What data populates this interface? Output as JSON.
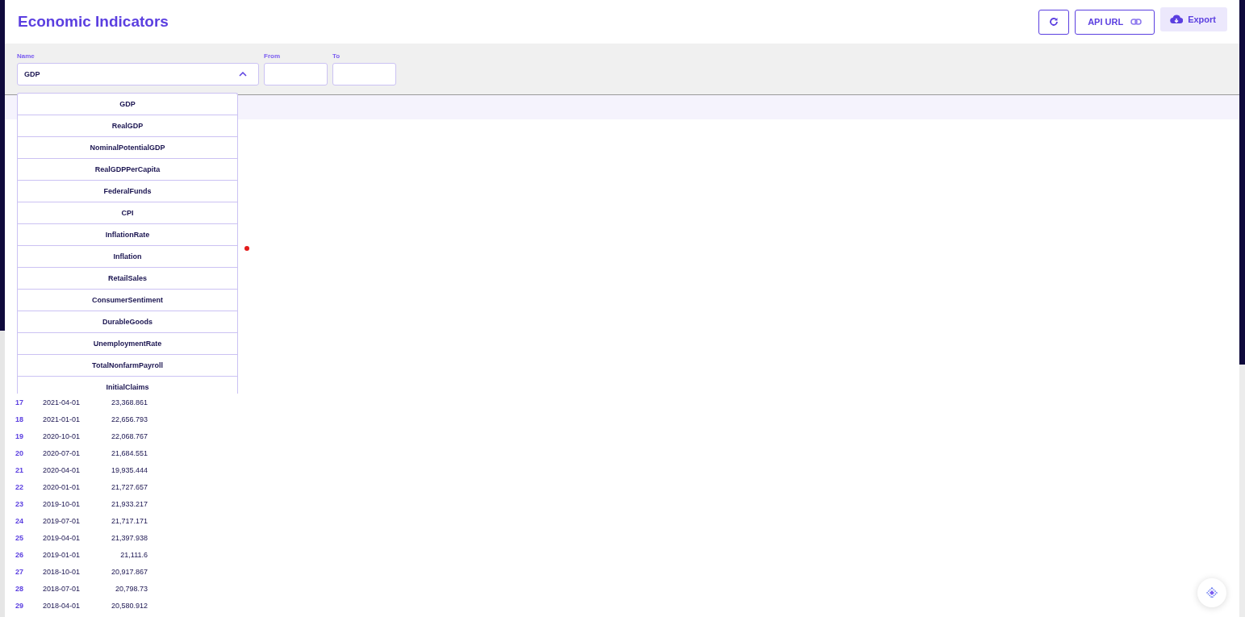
{
  "header": {
    "title": "Economic Indicators",
    "buttons": [
      {
        "kind": "refresh"
      },
      {
        "kind": "link",
        "label": "API URL"
      },
      {
        "kind": "export",
        "label": "Export"
      }
    ]
  },
  "filters": {
    "name": {
      "label": "Name",
      "value": "GDP",
      "expanded": true,
      "options": [
        "GDP",
        "RealGDP",
        "NominalPotentialGDP",
        "RealGDPPerCapita",
        "FederalFunds",
        "CPI",
        "InflationRate",
        "Inflation",
        "RetailSales",
        "ConsumerSentiment",
        "DurableGoods",
        "UnemploymentRate",
        "TotalNonfarmPayroll",
        "InitialClaims"
      ]
    },
    "from": {
      "label": "From"
    },
    "to": {
      "label": "To"
    }
  },
  "table": {
    "rows": [
      {
        "index": "17",
        "date": "2021-04-01",
        "value": "23,368.861"
      },
      {
        "index": "18",
        "date": "2021-01-01",
        "value": "22,656.793"
      },
      {
        "index": "19",
        "date": "2020-10-01",
        "value": "22,068.767"
      },
      {
        "index": "20",
        "date": "2020-07-01",
        "value": "21,684.551"
      },
      {
        "index": "21",
        "date": "2020-04-01",
        "value": "19,935.444"
      },
      {
        "index": "22",
        "date": "2020-01-01",
        "value": "21,727.657"
      },
      {
        "index": "23",
        "date": "2019-10-01",
        "value": "21,933.217"
      },
      {
        "index": "24",
        "date": "2019-07-01",
        "value": "21,717.171"
      },
      {
        "index": "25",
        "date": "2019-04-01",
        "value": "21,397.938"
      },
      {
        "index": "26",
        "date": "2019-01-01",
        "value": "21,111.6"
      },
      {
        "index": "27",
        "date": "2018-10-01",
        "value": "20,917.867"
      },
      {
        "index": "28",
        "date": "2018-07-01",
        "value": "20,798.73"
      },
      {
        "index": "29",
        "date": "2018-04-01",
        "value": "20,580.912"
      }
    ]
  }
}
